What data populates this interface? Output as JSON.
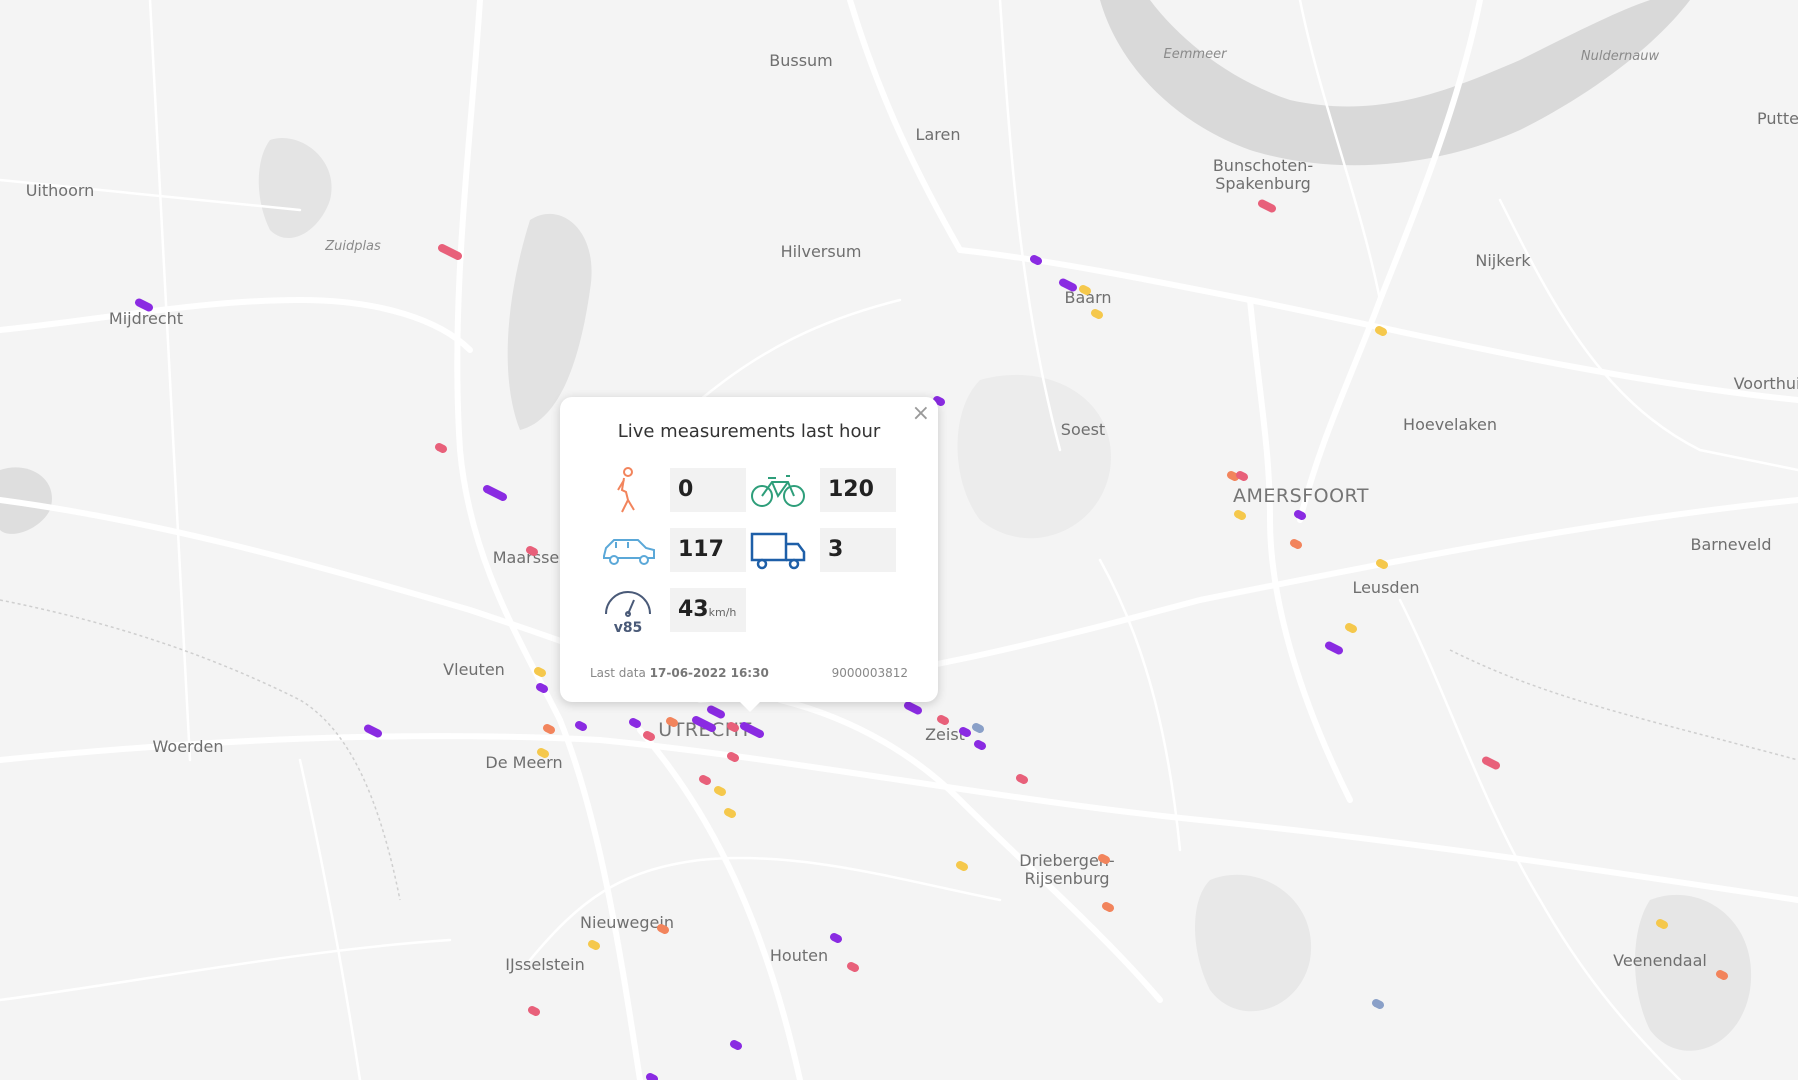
{
  "map": {
    "places": [
      {
        "name": "Bussum",
        "cls": ""
      },
      {
        "name": "Laren",
        "cls": ""
      },
      {
        "name": "Hilversum",
        "cls": ""
      },
      {
        "name": "Uithoorn",
        "cls": ""
      },
      {
        "name": "Mijdrecht",
        "cls": ""
      },
      {
        "name": "Zuidplas",
        "cls": "water"
      },
      {
        "name": "Eemmeer",
        "cls": "water"
      },
      {
        "name": "Nuldernauw",
        "cls": "water"
      },
      {
        "name": "Putte",
        "cls": ""
      },
      {
        "name": "Bunschoten-\nSpakenburg",
        "cls": ""
      },
      {
        "name": "Nijkerk",
        "cls": ""
      },
      {
        "name": "Baarn",
        "cls": ""
      },
      {
        "name": "Soest",
        "cls": ""
      },
      {
        "name": "Hoevelaken",
        "cls": ""
      },
      {
        "name": "Voorthui",
        "cls": ""
      },
      {
        "name": "AMERSFOORT",
        "cls": "big"
      },
      {
        "name": "Barneveld",
        "cls": ""
      },
      {
        "name": "Leusden",
        "cls": ""
      },
      {
        "name": "Maarsse",
        "cls": ""
      },
      {
        "name": "Vleuten",
        "cls": ""
      },
      {
        "name": "Woerden",
        "cls": ""
      },
      {
        "name": "De Meern",
        "cls": ""
      },
      {
        "name": "UTRECHT",
        "cls": "big"
      },
      {
        "name": "Zeist",
        "cls": ""
      },
      {
        "name": "Driebergen-\nRijsenburg",
        "cls": ""
      },
      {
        "name": "Nieuwegein",
        "cls": ""
      },
      {
        "name": "IJsselstein",
        "cls": ""
      },
      {
        "name": "Houten",
        "cls": ""
      },
      {
        "name": "Veenendaal",
        "cls": ""
      }
    ],
    "marker_colors": {
      "purple": "#8a2be2",
      "pink": "#e8607a",
      "orange": "#f2845c",
      "yellow": "#f5c84c",
      "blue": "#8aa0c8"
    }
  },
  "popup": {
    "title": "Live measurements last hour",
    "close": "×",
    "metrics": [
      {
        "icon": "pedestrian-icon",
        "value": "0",
        "unit": ""
      },
      {
        "icon": "bicycle-icon",
        "value": "120",
        "unit": ""
      },
      {
        "icon": "car-icon",
        "value": "117",
        "unit": ""
      },
      {
        "icon": "truck-icon",
        "value": "3",
        "unit": ""
      },
      {
        "icon": "v85-speed-icon",
        "value": "43",
        "unit": "km/h"
      }
    ],
    "v85_label": "v85",
    "last_data_label": "Last data",
    "last_data_value": "17-06-2022 16:30",
    "sensor_id": "9000003812"
  }
}
